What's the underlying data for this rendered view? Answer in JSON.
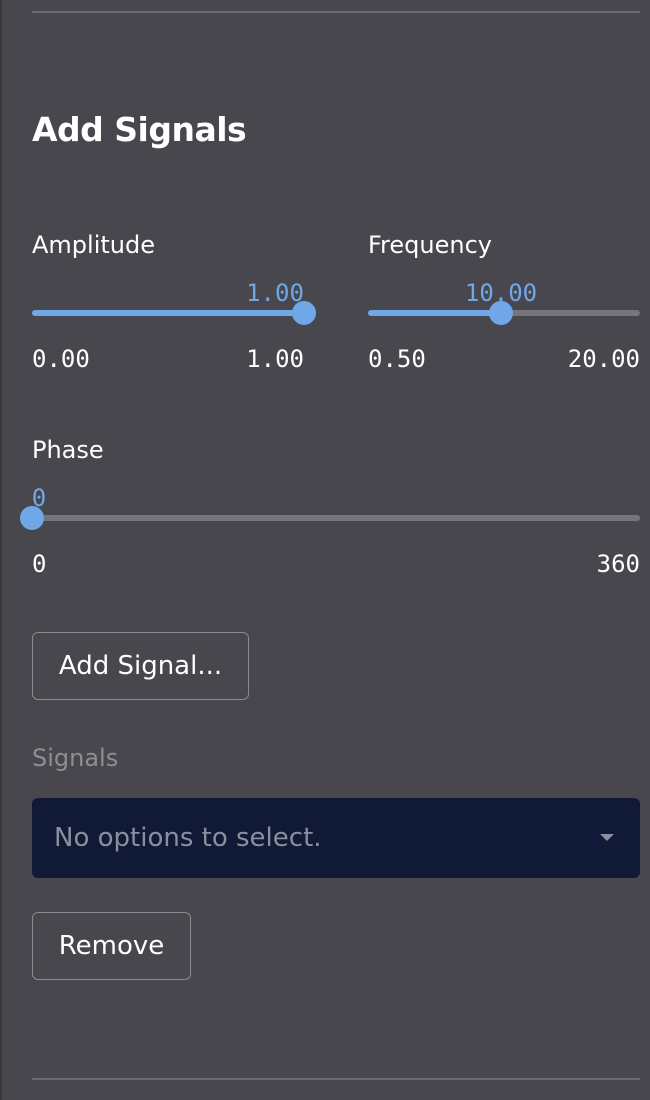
{
  "section_title": "Add Signals",
  "sliders": {
    "amplitude": {
      "label": "Amplitude",
      "value": "1.00",
      "min": "0.00",
      "max": "1.00",
      "fraction": 1.0
    },
    "frequency": {
      "label": "Frequency",
      "value": "10.00",
      "min": "0.50",
      "max": "20.00",
      "fraction": 0.4872
    },
    "phase": {
      "label": "Phase",
      "value": "0",
      "min": "0",
      "max": "360",
      "fraction": 0.0
    }
  },
  "buttons": {
    "add_signal": "Add Signal...",
    "remove": "Remove"
  },
  "signals": {
    "label": "Signals",
    "placeholder": "No options to select."
  },
  "colors": {
    "accent": "#6fa7e8",
    "background": "#47474d",
    "select_background": "#101935",
    "track": "#75757b"
  },
  "icons": {
    "dropdown": "chevron-down-icon"
  }
}
